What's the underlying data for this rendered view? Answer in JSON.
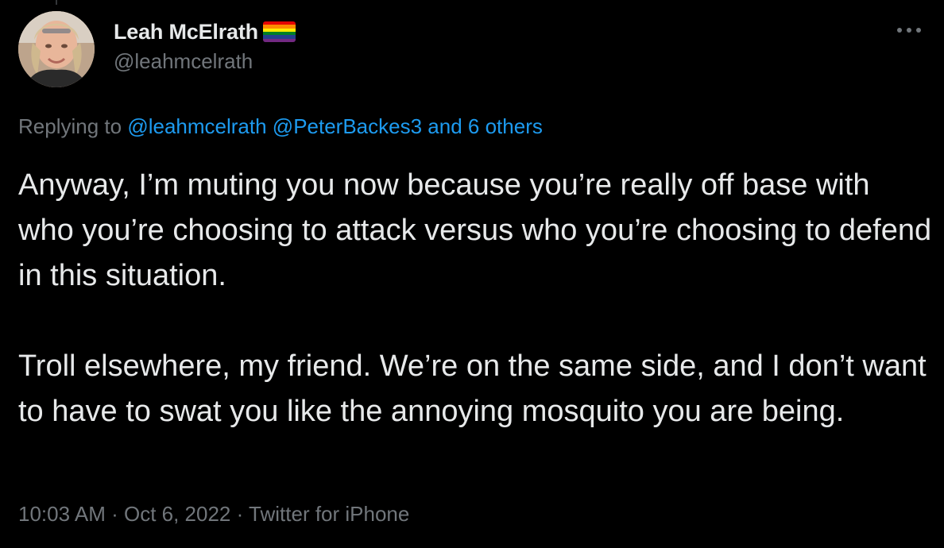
{
  "author": {
    "display_name": "Leah McElrath",
    "handle": "@leahmcelrath",
    "flag_icon": "rainbow-flag-icon",
    "flag_colors": [
      "#e40303",
      "#ff8c00",
      "#ffed00",
      "#008026",
      "#24408e",
      "#732982"
    ]
  },
  "more_icon": "more-options-icon",
  "reply": {
    "prefix": "Replying to",
    "mention_1": "@leahmcelrath",
    "mention_2": "@PeterBackes3",
    "others": "and 6 others"
  },
  "tweet": {
    "paragraph_1": "Anyway, I’m muting you now because you’re really off base with who you’re choosing to attack versus who you’re choosing to defend in this situation.",
    "paragraph_2": "Troll elsewhere, my friend. We’re on the same side, and I don’t want to have to swat you like the annoying mosquito you are being."
  },
  "meta": {
    "time": "10:03 AM",
    "separator": " · ",
    "date": "Oct 6, 2022",
    "source": "Twitter for iPhone"
  },
  "colors": {
    "background": "#000000",
    "text": "#e7e9ea",
    "secondary": "#71767b",
    "link": "#1d9bf0"
  }
}
